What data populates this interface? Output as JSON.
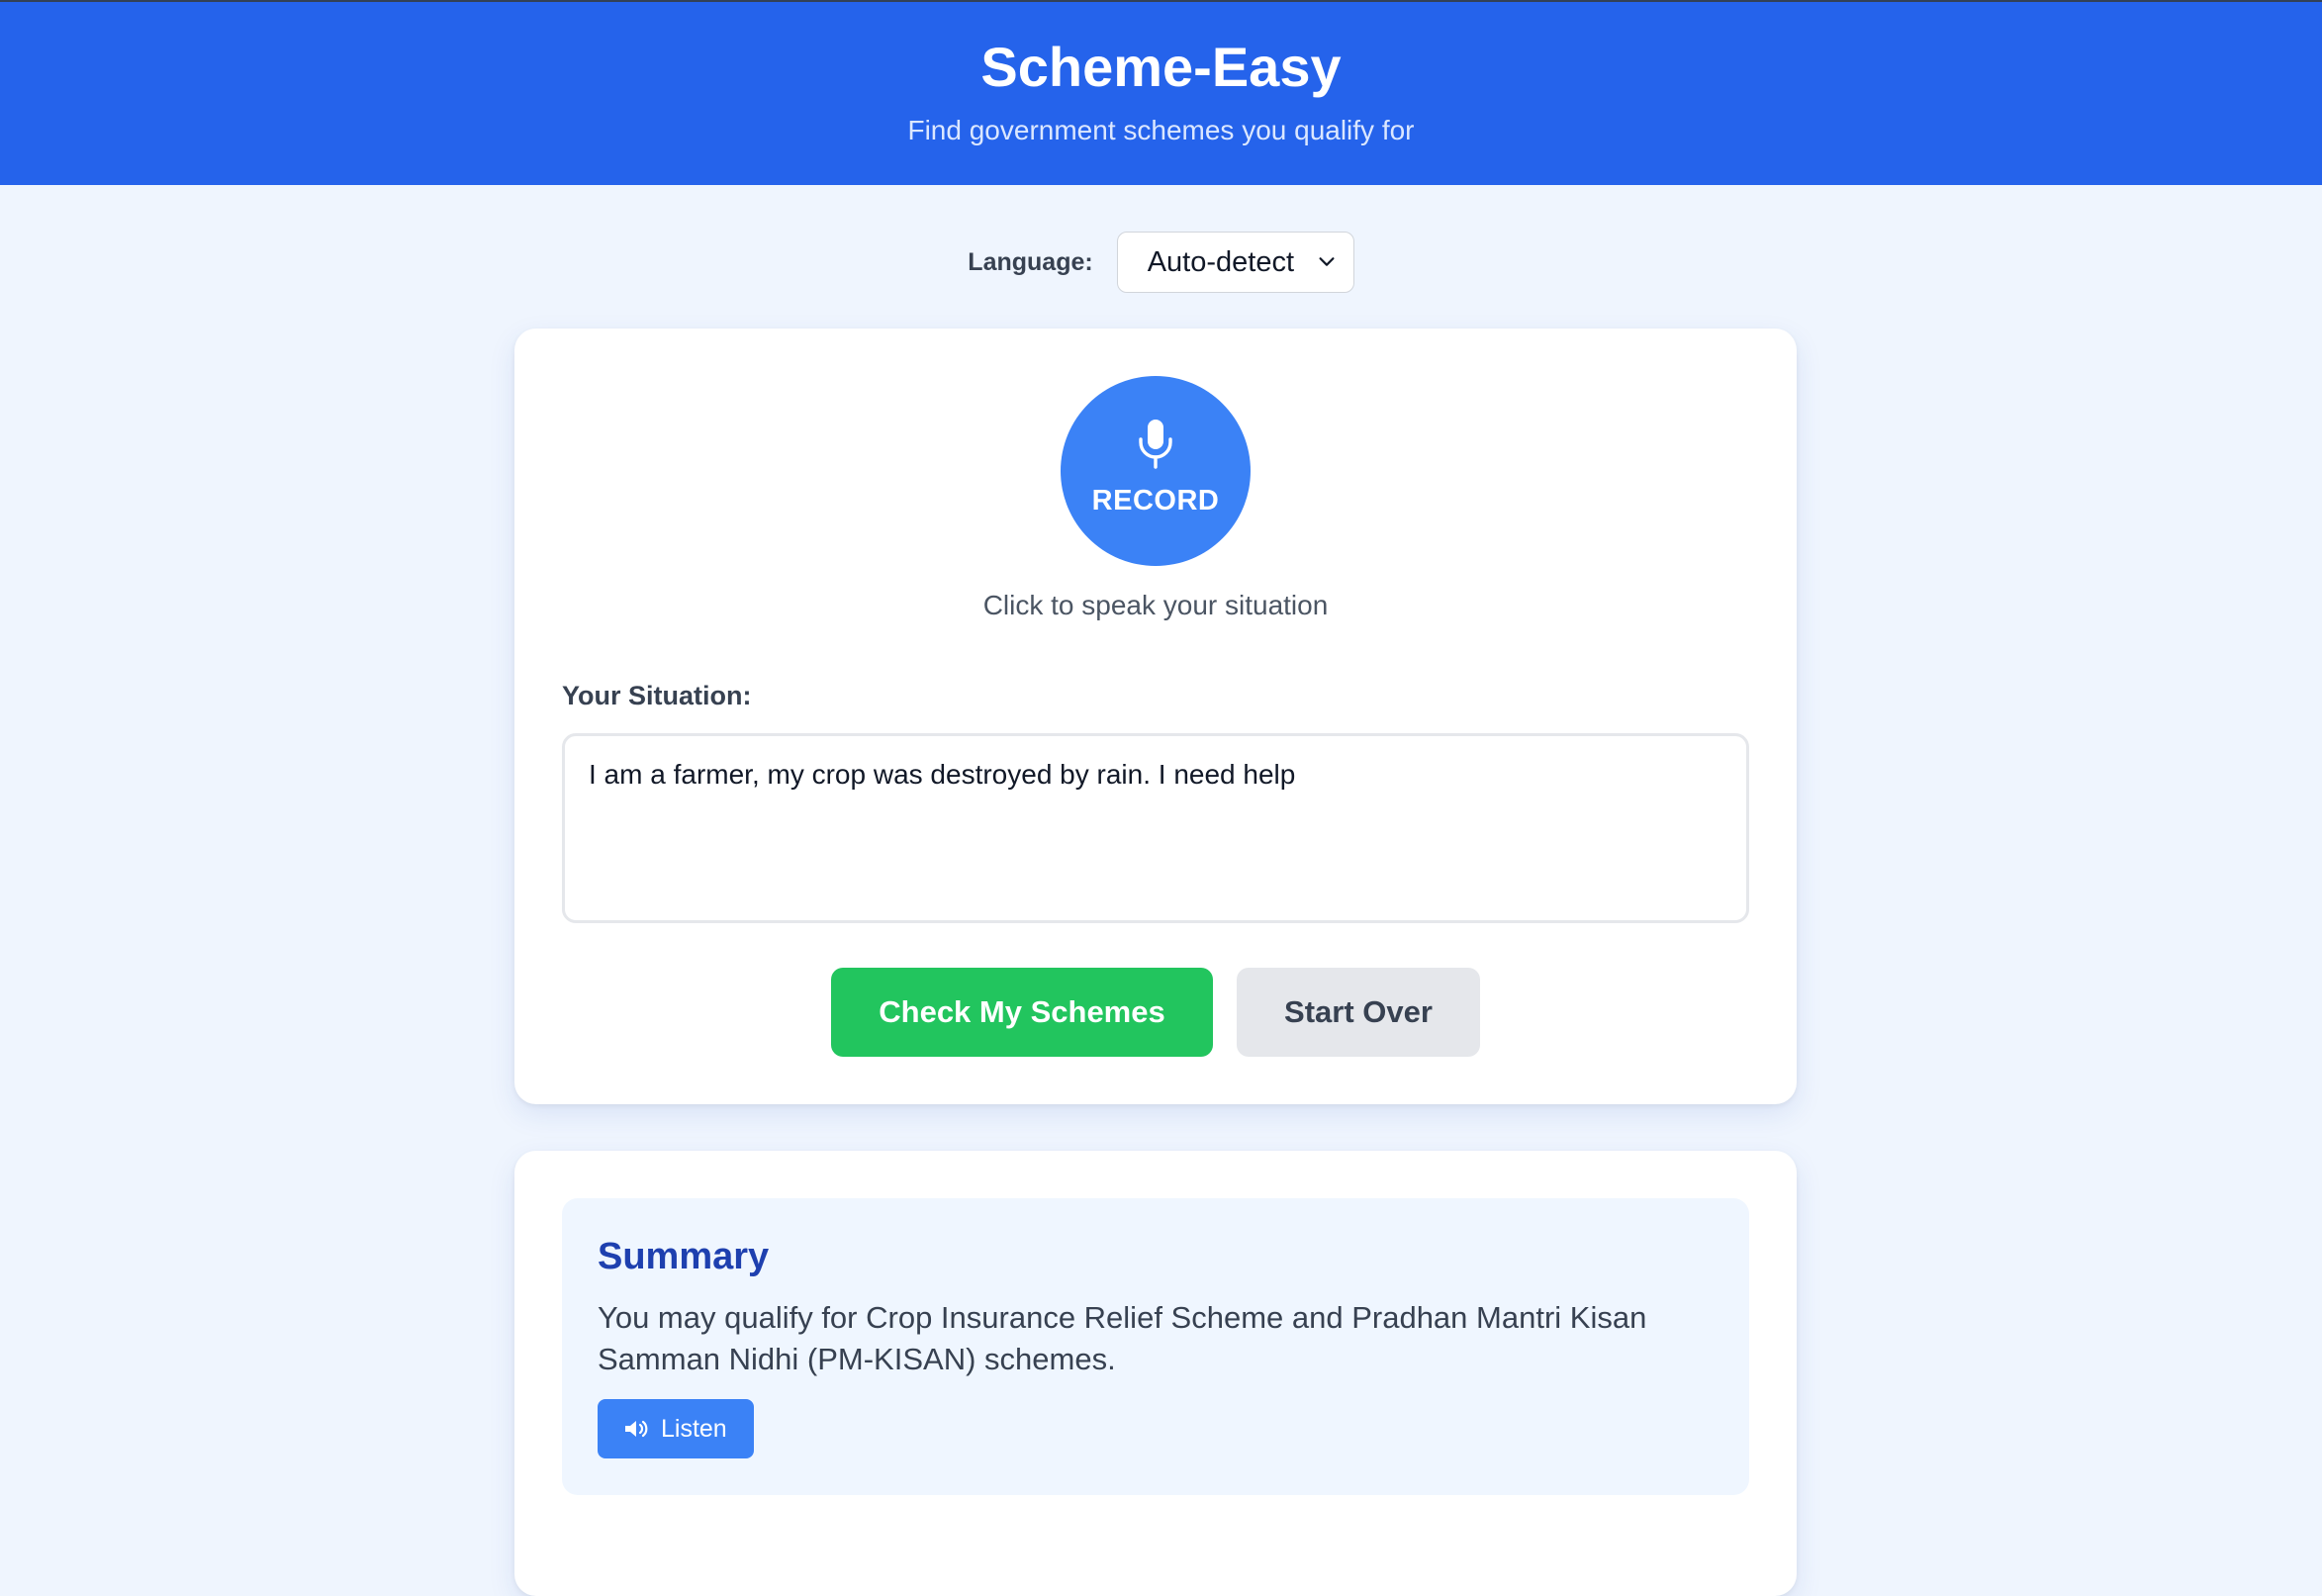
{
  "header": {
    "title": "Scheme-Easy",
    "subtitle": "Find government schemes you qualify for"
  },
  "language": {
    "label": "Language:",
    "selected": "Auto-detect"
  },
  "record": {
    "label": "RECORD",
    "hint": "Click to speak your situation"
  },
  "situation": {
    "label": "Your Situation:",
    "value": "I am a farmer, my crop was destroyed by rain. I need help"
  },
  "actions": {
    "check_label": "Check My Schemes",
    "reset_label": "Start Over"
  },
  "summary": {
    "title": "Summary",
    "text": "You may qualify for Crop Insurance Relief Scheme and Pradhan Mantri Kisan Samman Nidhi (PM-KISAN) schemes.",
    "listen_label": "Listen"
  },
  "icons": {
    "record": "microphone-icon",
    "language_dropdown": "chevron-down-icon",
    "listen": "speaker-icon"
  },
  "colors": {
    "header_bg": "#2563eb",
    "page_bg": "#eff5fe",
    "record_button": "#3b82f6",
    "check_button": "#22c55e",
    "reset_button": "#e5e7eb",
    "summary_title": "#1e40af"
  }
}
